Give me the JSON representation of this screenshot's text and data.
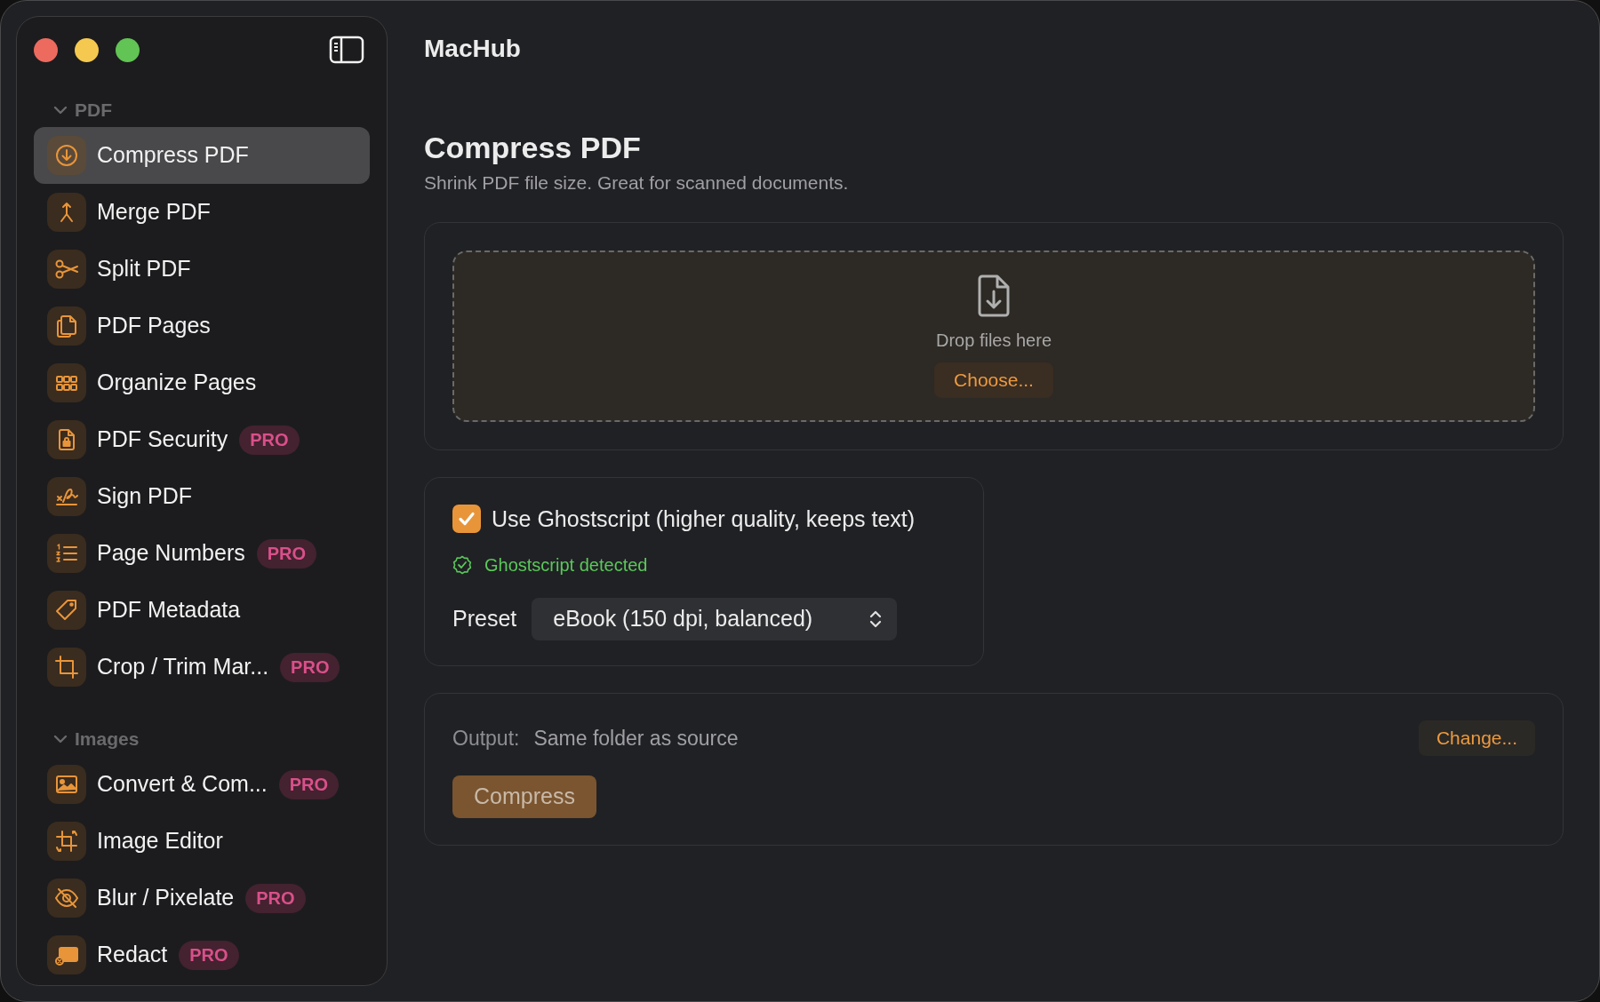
{
  "window": {
    "title": "MacHub"
  },
  "sidebar": {
    "sections": [
      {
        "label": "PDF",
        "expanded": true,
        "items": [
          {
            "label": "Compress PDF",
            "selected": true
          },
          {
            "label": "Merge PDF",
            "selected": false
          },
          {
            "label": "Split PDF",
            "selected": false
          },
          {
            "label": "PDF Pages",
            "selected": false
          },
          {
            "label": "Organize Pages",
            "selected": false
          },
          {
            "label": "PDF Security",
            "selected": false,
            "badge": "PRO"
          },
          {
            "label": "Sign PDF",
            "selected": false
          },
          {
            "label": "Page Numbers",
            "selected": false,
            "badge": "PRO"
          },
          {
            "label": "PDF Metadata",
            "selected": false
          },
          {
            "label": "Crop / Trim Mar...",
            "selected": false,
            "badge": "PRO"
          }
        ]
      },
      {
        "label": "Images",
        "expanded": true,
        "items": [
          {
            "label": "Convert & Com...",
            "selected": false,
            "badge": "PRO"
          },
          {
            "label": "Image Editor",
            "selected": false
          },
          {
            "label": "Blur / Pixelate",
            "selected": false,
            "badge": "PRO"
          },
          {
            "label": "Redact",
            "selected": false,
            "badge": "PRO"
          }
        ]
      }
    ]
  },
  "page": {
    "title": "Compress PDF",
    "subtitle": "Shrink PDF file size. Great for scanned documents."
  },
  "drop_zone": {
    "label": "Drop files here",
    "button": "Choose..."
  },
  "options": {
    "ghostscript": {
      "label": "Use Ghostscript (higher quality, keeps text)",
      "checked": true
    },
    "status": "Ghostscript detected",
    "preset": {
      "label": "Preset",
      "value": "eBook (150 dpi, balanced)"
    }
  },
  "output": {
    "label": "Output:",
    "value": "Same folder as source",
    "change_button": "Change...",
    "action_button": "Compress",
    "action_disabled": true
  }
}
